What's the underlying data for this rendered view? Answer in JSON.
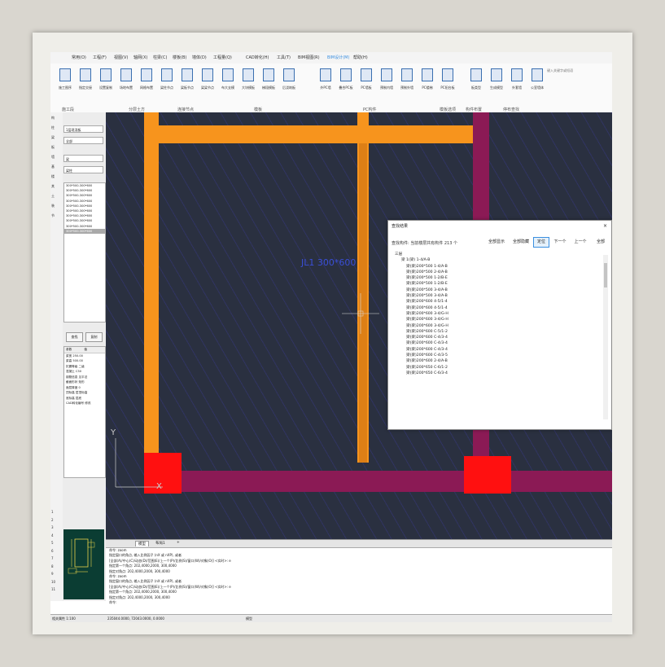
{
  "menu": [
    "常用(O)",
    "工程(F)",
    "视图(V)",
    "轴网(X)",
    "柱梁(C)",
    "楼板(B)",
    "墙体(D)",
    "工程量(Q)",
    "CAD转化(H)",
    "工具(T)",
    "BIM视图(R)",
    "BIM设计(M)",
    "帮助(H)"
  ],
  "menu_active_index": 11,
  "ribbon_buttons": [
    "施工图序",
    "指定交接",
    "设置复制",
    "场地布置",
    "网格布置",
    "梁柱节点",
    "梁板节点",
    "梁梁节点",
    "布大支模",
    "大块模板",
    "梯段模板",
    "后浇筑板",
    "外PC墙",
    "叠合PC板",
    "PC墙板",
    "预制内墙",
    "预制外墙",
    "PC楼梯",
    "PC阳台板",
    "板类型",
    "生成模型",
    "外套墙",
    "公室墙体",
    "分配图层"
  ],
  "ribbon_groups": [
    "施工段",
    "分层土方",
    "连接节点",
    "模板",
    "PC构件",
    "模板选项",
    "构件布置",
    "停布查找"
  ],
  "search_placeholder": "键入关键字或短语",
  "left_strip": [
    "构",
    "柱",
    "梁",
    "板",
    "墙",
    "基",
    "楼",
    "其",
    "土",
    "装",
    "节"
  ],
  "left_strip_bottom": [
    "1",
    "2",
    "3",
    "4",
    "5",
    "6",
    "7",
    "8",
    "9",
    "10",
    "11"
  ],
  "filter_combos": [
    "1层现浇板",
    "全部",
    "梁",
    "梁柱"
  ],
  "list_items": [
    "300*500-300*600",
    "300*500-300*600",
    "300*500-300*600",
    "300*500-300*600",
    "300*500-300*600",
    "300*500-300*600",
    "300*500-300*600",
    "300*500-300*600",
    "300*500-300*600",
    "300*500-300*600"
  ],
  "list_selected_index": 9,
  "panel_buttons": [
    "查找",
    "复制"
  ],
  "props_header": [
    "参数",
    "值"
  ],
  "props": [
    "梁宽 250.00",
    "梁高 500.00",
    "抗震等级 二级",
    "混凝土 C30",
    "钢筋信息 见平法",
    "截面形状 矩形",
    "面层厚度 0",
    "顶标高 层顶标高",
    "底标高 层底",
    "CAD转化编号 修改"
  ],
  "tabs": [
    "模型",
    "布局1",
    "+"
  ],
  "tabs_active_index": 0,
  "command_lines": [
    "命令: zoom",
    "指定窗口的角点, 输入比例因子 (nX 或 nXP), 或者",
    "[全部(A)/中心(C)/动态(D)/范围(E)/上一个(P)/比例(S)/窗口(W)/对象(O)] <实时>: e",
    "指定第一个角点: 202,4000,2000, 300,4000",
    "指定对角点: 202,4000,2000, 300,4000",
    "命令: zoom",
    "指定窗口的角点, 输入比例因子 (nX 或 nXP), 或者",
    "[全部(A)/中心(C)/动态(D)/范围(E)/上一个(P)/比例(S)/窗口(W)/对象(O)] <实时>: e",
    "指定第一个角点: 202,4000,2000, 300,4000",
    "指定对角点: 202,4000,2000, 300,4000",
    "命令:"
  ],
  "status_coords": "235044.0000, 72043.0000, 0.0000",
  "status_left": "相关属性 1:100",
  "status_model": "模型",
  "dialog": {
    "title": "查找结果",
    "info": "查找构件: 当前楼层共有构件 213 个",
    "buttons": [
      "全部显示",
      "全部隐藏",
      "定位",
      "下一个",
      "上一个",
      "全部"
    ],
    "active_button_index": 2,
    "close": "×",
    "tree_root": "三层",
    "tree_group": "梁 1(梁) 1-4/A-B",
    "rows": [
      "梁(梁)200*500  1-4/A-B",
      "梁(梁)200*500  2-4/A-B",
      "梁(梁)200*500  1-2/B-E",
      "梁(梁)200*500  1-2/B-E",
      "梁(梁)200*500  3-4/A-B",
      "梁(梁)200*500  3-4/A-B",
      "梁(梁)200*600  4-5/1-4",
      "梁(梁)200*600  4-5/1-4",
      "梁(梁)200*600  3-4/G-H",
      "梁(梁)200*600  3-4/G-H",
      "梁(梁)200*600  3-4/G-H",
      "梁(梁)200*600  C-5/1-2",
      "梁(梁)200*600  C-4/3-4",
      "梁(梁)200*600  C-4/3-4",
      "梁(梁)200*600  C-4/3-4",
      "梁(梁)200*600  C-4/3-5",
      "梁(梁)200*600  2-4/A-B",
      "梁(梁)200*650  C-6/1-2",
      "梁(梁)200*650  C-6/3-4"
    ]
  },
  "canvas_labels": {
    "beam_tag": "JL1 300*600",
    "axis_y": "Y",
    "axis_x": "X"
  },
  "colors": {
    "canvas_bg": "#2a3040",
    "beam_orange": "#f7941d",
    "wall_magenta": "#8b1a55",
    "column_red": "#ff1010",
    "accent": "#3a8fe0"
  }
}
